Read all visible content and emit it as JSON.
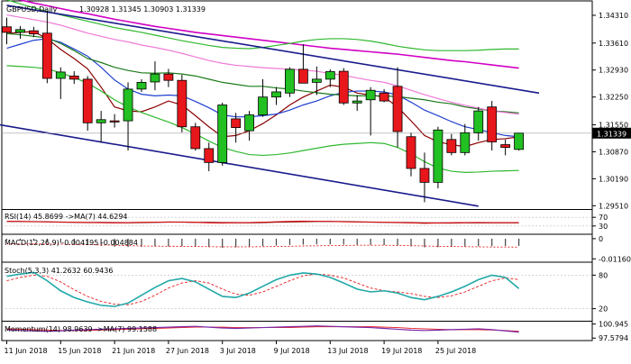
{
  "chart_data": [
    {
      "type": "candlestick",
      "panel": "price",
      "title": "GBPUSD,Daily",
      "ohlc_label": "1.30928 1.31345 1.30903 1.31339",
      "last_price": "1.31339",
      "yticks": [
        "1.34310",
        "1.33610",
        "1.32930",
        "1.32250",
        "1.31550",
        "1.30870",
        "1.30190",
        "1.29510"
      ],
      "ylim": [
        1.2945,
        1.3465
      ],
      "x_labels": [
        "11 Jun 2018",
        "15 Jun 2018",
        "21 Jun 2018",
        "27 Jun 2018",
        "3 Jul 2018",
        "9 Jul 2018",
        "13 Jul 2018",
        "19 Jul 2018",
        "25 Jul 2018"
      ],
      "candles": [
        {
          "o": 1.3402,
          "h": 1.3425,
          "l": 1.3358,
          "c": 1.3388
        },
        {
          "o": 1.3388,
          "h": 1.3404,
          "l": 1.3372,
          "c": 1.3395
        },
        {
          "o": 1.3392,
          "h": 1.3402,
          "l": 1.3376,
          "c": 1.3384
        },
        {
          "o": 1.3386,
          "h": 1.344,
          "l": 1.326,
          "c": 1.3272
        },
        {
          "o": 1.3272,
          "h": 1.33,
          "l": 1.322,
          "c": 1.3288
        },
        {
          "o": 1.3278,
          "h": 1.329,
          "l": 1.3258,
          "c": 1.327
        },
        {
          "o": 1.327,
          "h": 1.3278,
          "l": 1.314,
          "c": 1.316
        },
        {
          "o": 1.316,
          "h": 1.319,
          "l": 1.311,
          "c": 1.3168
        },
        {
          "o": 1.3165,
          "h": 1.3182,
          "l": 1.3148,
          "c": 1.3162
        },
        {
          "o": 1.3165,
          "h": 1.3262,
          "l": 1.309,
          "c": 1.3245
        },
        {
          "o": 1.3245,
          "h": 1.327,
          "l": 1.3238,
          "c": 1.3262
        },
        {
          "o": 1.3263,
          "h": 1.3315,
          "l": 1.3242,
          "c": 1.3283
        },
        {
          "o": 1.3283,
          "h": 1.3296,
          "l": 1.325,
          "c": 1.3267
        },
        {
          "o": 1.3267,
          "h": 1.3281,
          "l": 1.3136,
          "c": 1.315
        },
        {
          "o": 1.315,
          "h": 1.316,
          "l": 1.309,
          "c": 1.3095
        },
        {
          "o": 1.3095,
          "h": 1.311,
          "l": 1.3038,
          "c": 1.306
        },
        {
          "o": 1.306,
          "h": 1.3211,
          "l": 1.3052,
          "c": 1.3205
        },
        {
          "o": 1.317,
          "h": 1.3185,
          "l": 1.311,
          "c": 1.3148
        },
        {
          "o": 1.314,
          "h": 1.319,
          "l": 1.3115,
          "c": 1.318
        },
        {
          "o": 1.318,
          "h": 1.327,
          "l": 1.3175,
          "c": 1.3225
        },
        {
          "o": 1.3225,
          "h": 1.325,
          "l": 1.3205,
          "c": 1.3238
        },
        {
          "o": 1.3235,
          "h": 1.33,
          "l": 1.3225,
          "c": 1.3295
        },
        {
          "o": 1.3295,
          "h": 1.3358,
          "l": 1.3262,
          "c": 1.326
        },
        {
          "o": 1.3262,
          "h": 1.3302,
          "l": 1.323,
          "c": 1.327
        },
        {
          "o": 1.327,
          "h": 1.3295,
          "l": 1.325,
          "c": 1.3289
        },
        {
          "o": 1.329,
          "h": 1.3298,
          "l": 1.3205,
          "c": 1.321
        },
        {
          "o": 1.321,
          "h": 1.323,
          "l": 1.319,
          "c": 1.3215
        },
        {
          "o": 1.3218,
          "h": 1.325,
          "l": 1.3128,
          "c": 1.3242
        },
        {
          "o": 1.3235,
          "h": 1.3245,
          "l": 1.3212,
          "c": 1.3215
        },
        {
          "o": 1.3252,
          "h": 1.33,
          "l": 1.3098,
          "c": 1.3138
        },
        {
          "o": 1.3125,
          "h": 1.3135,
          "l": 1.3025,
          "c": 1.3045
        },
        {
          "o": 1.3045,
          "h": 1.3085,
          "l": 1.296,
          "c": 1.301
        },
        {
          "o": 1.301,
          "h": 1.315,
          "l": 1.2995,
          "c": 1.3142
        },
        {
          "o": 1.3118,
          "h": 1.3132,
          "l": 1.3078,
          "c": 1.3085
        },
        {
          "o": 1.3085,
          "h": 1.3157,
          "l": 1.3078,
          "c": 1.3135
        },
        {
          "o": 1.3135,
          "h": 1.32,
          "l": 1.3115,
          "c": 1.319
        },
        {
          "o": 1.32,
          "h": 1.3215,
          "l": 1.309,
          "c": 1.3112
        },
        {
          "o": 1.3105,
          "h": 1.3118,
          "l": 1.3078,
          "c": 1.3098
        },
        {
          "o": 1.3093,
          "h": 1.3135,
          "l": 1.309,
          "c": 1.3134
        }
      ],
      "moving_averages": [
        {
          "color": "#8b0000",
          "values": [
            1.3385,
            1.3388,
            1.339,
            1.3372,
            1.3345,
            1.3322,
            1.3296,
            1.325,
            1.32,
            1.319,
            1.3188,
            1.32,
            1.3215,
            1.3205,
            1.3178,
            1.315,
            1.3125,
            1.3128,
            1.314,
            1.3158,
            1.318,
            1.3205,
            1.3225,
            1.324,
            1.3255,
            1.325,
            1.3235,
            1.323,
            1.3225,
            1.32,
            1.3165,
            1.3128,
            1.3112,
            1.3105,
            1.31,
            1.311,
            1.3118,
            1.312,
            1.3125
          ]
        },
        {
          "color": "#1f3fd0",
          "values": [
            1.3348,
            1.3358,
            1.3368,
            1.3372,
            1.3363,
            1.3346,
            1.3328,
            1.33,
            1.3268,
            1.3245,
            1.3232,
            1.3228,
            1.323,
            1.3228,
            1.3214,
            1.3198,
            1.318,
            1.3175,
            1.3175,
            1.3178,
            1.3182,
            1.3192,
            1.3205,
            1.3215,
            1.3228,
            1.3237,
            1.324,
            1.324,
            1.3238,
            1.323,
            1.3212,
            1.3192,
            1.3178,
            1.3163,
            1.315,
            1.3143,
            1.3135,
            1.3128,
            1.3125
          ]
        },
        {
          "color": "#1a7a1a",
          "values": [
            1.3385,
            1.3382,
            1.3378,
            1.3374,
            1.336,
            1.3342,
            1.3322,
            1.3312,
            1.33,
            1.3292,
            1.3286,
            1.3285,
            1.3286,
            1.3283,
            1.3278,
            1.327,
            1.3262,
            1.3257,
            1.3252,
            1.3252,
            1.3248,
            1.3245,
            1.324,
            1.3236,
            1.3232,
            1.323,
            1.3228,
            1.3228,
            1.3228,
            1.3226,
            1.3222,
            1.3218,
            1.3212,
            1.3208,
            1.32,
            1.3195,
            1.319,
            1.3188,
            1.3185
          ]
        },
        {
          "color": "#ef7ad6",
          "values": [
            1.3432,
            1.3426,
            1.342,
            1.3414,
            1.3406,
            1.3396,
            1.3386,
            1.3378,
            1.337,
            1.3364,
            1.3356,
            1.335,
            1.3343,
            1.3335,
            1.3326,
            1.3317,
            1.331,
            1.3305,
            1.3302,
            1.3299,
            1.3297,
            1.3295,
            1.3293,
            1.329,
            1.3284,
            1.328,
            1.3273,
            1.3267,
            1.3262,
            1.3253,
            1.3242,
            1.3231,
            1.3221,
            1.3212,
            1.3204,
            1.3197,
            1.319,
            1.3186,
            1.3182
          ]
        },
        {
          "color": "#d100c4",
          "values": [
            1.3478,
            1.347,
            1.3462,
            1.3455,
            1.3448,
            1.3441,
            1.3435,
            1.3428,
            1.3421,
            1.3415,
            1.3409,
            1.3403,
            1.3398,
            1.3393,
            1.3388,
            1.3384,
            1.338,
            1.3376,
            1.3372,
            1.3368,
            1.3364,
            1.336,
            1.3356,
            1.3352,
            1.3348,
            1.3345,
            1.3342,
            1.3339,
            1.3336,
            1.3333,
            1.3329,
            1.3325,
            1.3321,
            1.3317,
            1.3314,
            1.331,
            1.3306,
            1.3302,
            1.3298
          ]
        },
        {
          "color": "#2fb82f",
          "values": [
            1.347,
            1.346,
            1.345,
            1.3441,
            1.3432,
            1.3424,
            1.3416,
            1.3408,
            1.34,
            1.3394,
            1.3388,
            1.3381,
            1.3374,
            1.3367,
            1.3361,
            1.3355,
            1.335,
            1.3348,
            1.3347,
            1.335,
            1.3355,
            1.336,
            1.3366,
            1.337,
            1.3372,
            1.3372,
            1.337,
            1.3366,
            1.336,
            1.3353,
            1.3348,
            1.3344,
            1.3342,
            1.3342,
            1.3342,
            1.3343,
            1.3345,
            1.3346,
            1.3346
          ]
        },
        {
          "color": "#2fb82f",
          "values": [
            1.3304,
            1.3302,
            1.33,
            1.3296,
            1.3286,
            1.3274,
            1.326,
            1.324,
            1.3218,
            1.32,
            1.3186,
            1.3174,
            1.3162,
            1.3148,
            1.3132,
            1.3114,
            1.3098,
            1.3088,
            1.308,
            1.3078,
            1.308,
            1.3084,
            1.309,
            1.3096,
            1.3102,
            1.3106,
            1.3108,
            1.311,
            1.3108,
            1.3098,
            1.3082,
            1.3062,
            1.3046,
            1.3038,
            1.3035,
            1.3036,
            1.3038,
            1.3039,
            1.304
          ]
        }
      ],
      "trendlines": [
        {
          "color": "#1a1a8c",
          "from": {
            "i": 0,
            "p": 1.3456
          },
          "to": {
            "i": 39.5,
            "p": 1.3235
          }
        },
        {
          "color": "#1a1a8c",
          "from": {
            "i": -0.5,
            "p": 1.3155
          },
          "to": {
            "i": 35,
            "p": 1.295
          }
        }
      ],
      "price_line": 1.3134
    },
    {
      "type": "line",
      "panel": "rsi",
      "label": "RSI(14) 45.8699  ->MA(7) 44.6294",
      "yticks": [
        "70",
        "30"
      ],
      "ylim": [
        0,
        100
      ],
      "levels": [
        70,
        30
      ],
      "rsi": [
        52,
        51,
        50,
        49,
        48,
        47,
        46,
        45,
        44,
        46,
        47,
        48,
        49,
        48,
        46,
        44,
        43,
        45,
        46,
        48,
        50,
        52,
        53,
        52,
        51,
        49,
        48,
        48,
        47,
        46,
        44,
        42,
        44,
        45,
        46,
        47,
        46,
        46,
        46
      ],
      "ma": [
        51,
        51,
        50,
        49,
        48,
        47,
        46,
        46,
        45,
        45,
        46,
        47,
        48,
        48,
        47,
        46,
        45,
        45,
        45,
        46,
        48,
        49,
        50,
        51,
        51,
        50,
        49,
        48,
        47,
        46,
        45,
        44,
        44,
        44,
        45,
        45,
        45,
        45,
        45
      ]
    },
    {
      "type": "bar",
      "panel": "macd",
      "label": "MACD(12,26,9) -0.004195 -0.004884",
      "yticks": [
        "0",
        "-0.011603"
      ],
      "ylim": [
        -0.0125,
        0.0015
      ],
      "macd": [
        -0.0008,
        -0.001,
        -0.0012,
        -0.0018,
        -0.0025,
        -0.003,
        -0.0036,
        -0.0042,
        -0.0046,
        -0.0048,
        -0.0048,
        -0.0046,
        -0.0044,
        -0.0044,
        -0.0046,
        -0.0049,
        -0.0052,
        -0.005,
        -0.0047,
        -0.0043,
        -0.004,
        -0.0036,
        -0.0034,
        -0.0033,
        -0.0033,
        -0.0034,
        -0.0035,
        -0.0036,
        -0.0037,
        -0.004,
        -0.0045,
        -0.005,
        -0.0049,
        -0.0048,
        -0.0046,
        -0.0044,
        -0.0043,
        -0.0042,
        -0.0042
      ],
      "signal": [
        -0.003,
        -0.003,
        -0.003,
        -0.0031,
        -0.0032,
        -0.0033,
        -0.0034,
        -0.0036,
        -0.0038,
        -0.004,
        -0.0042,
        -0.0043,
        -0.0044,
        -0.0044,
        -0.0045,
        -0.0046,
        -0.0047,
        -0.0047,
        -0.0047,
        -0.0046,
        -0.0045,
        -0.0044,
        -0.0042,
        -0.0041,
        -0.004,
        -0.0039,
        -0.0038,
        -0.0038,
        -0.0038,
        -0.0039,
        -0.004,
        -0.0042,
        -0.0044,
        -0.0045,
        -0.0046,
        -0.0047,
        -0.0048,
        -0.0048,
        -0.0049
      ]
    },
    {
      "type": "line",
      "panel": "stochastic",
      "label": "Stoch(5,3,3) 41.2632 60.9436",
      "yticks": [
        "80",
        "20"
      ],
      "ylim": [
        0,
        100
      ],
      "levels": [
        80,
        20
      ],
      "k": [
        78,
        82,
        85,
        70,
        52,
        40,
        32,
        26,
        24,
        30,
        44,
        58,
        70,
        74,
        68,
        55,
        42,
        40,
        48,
        60,
        72,
        80,
        84,
        82,
        76,
        66,
        55,
        50,
        52,
        48,
        40,
        36,
        42,
        50,
        60,
        72,
        80,
        76,
        56
      ],
      "d": [
        70,
        76,
        80,
        78,
        68,
        54,
        42,
        33,
        28,
        27,
        33,
        44,
        57,
        66,
        70,
        66,
        55,
        46,
        44,
        50,
        60,
        70,
        79,
        82,
        80,
        75,
        66,
        57,
        52,
        50,
        47,
        42,
        40,
        43,
        50,
        60,
        70,
        75,
        72
      ]
    },
    {
      "type": "line",
      "panel": "momentum",
      "label": "Momentum(14) 98.9639  ->MA(7) 99.1588",
      "yticks": [
        "100.945",
        "97.5794"
      ],
      "ylim": [
        97.2,
        101.3
      ],
      "momentum": [
        99.6,
        99.4,
        99.3,
        99.2,
        99.3,
        99.5,
        99.6,
        99.7,
        99.8,
        99.9,
        100.0,
        100.1,
        100.2,
        100.3,
        100.4,
        100.2,
        100.0,
        99.9,
        100.0,
        100.1,
        100.2,
        100.3,
        100.4,
        100.5,
        100.4,
        100.3,
        100.2,
        100.1,
        99.9,
        99.7,
        99.5,
        99.4,
        99.5,
        99.6,
        99.7,
        99.8,
        99.6,
        99.3,
        99.0
      ],
      "ma": [
        99.8,
        99.7,
        99.6,
        99.5,
        99.4,
        99.4,
        99.4,
        99.5,
        99.6,
        99.7,
        99.8,
        99.9,
        100.0,
        100.1,
        100.2,
        100.2,
        100.2,
        100.1,
        100.1,
        100.1,
        100.1,
        100.1,
        100.2,
        100.3,
        100.3,
        100.3,
        100.3,
        100.3,
        100.2,
        100.1,
        99.9,
        99.8,
        99.7,
        99.6,
        99.6,
        99.6,
        99.5,
        99.4,
        99.2
      ]
    }
  ]
}
